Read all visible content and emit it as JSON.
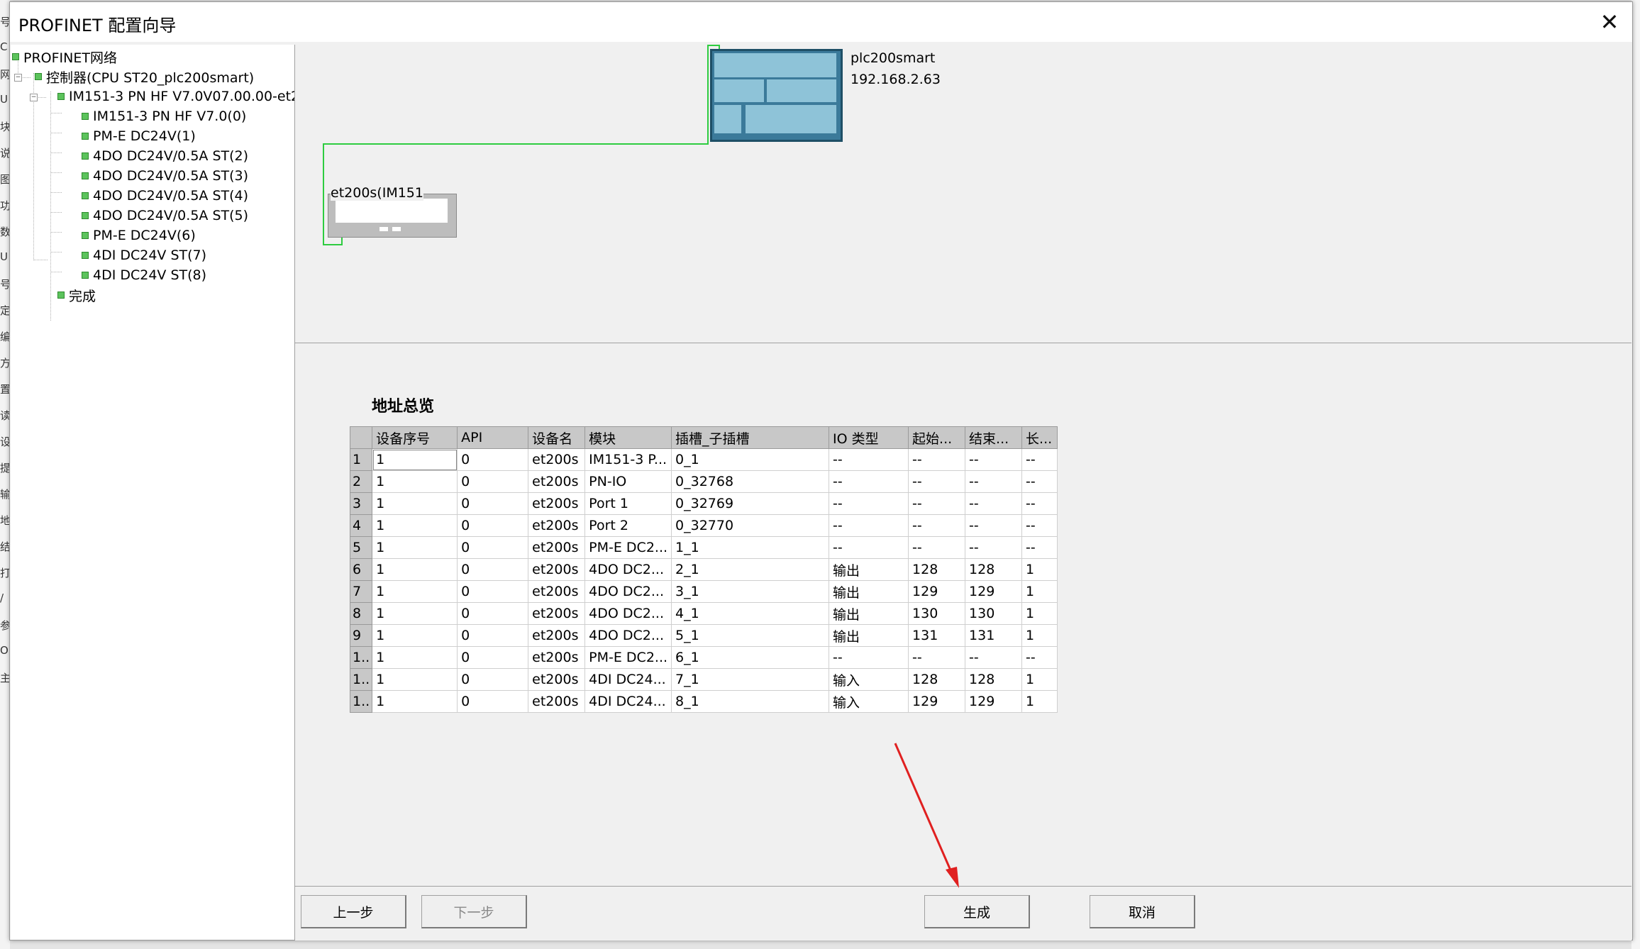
{
  "window": {
    "title": "PROFINET 配置向导"
  },
  "tree": {
    "root": "PROFINET网络",
    "controller": "控制器(CPU ST20_plc200smart)",
    "device": "IM151-3 PN HF V7.0V07.00.00-et2",
    "modules": [
      "IM151-3 PN HF V7.0(0)",
      "PM-E DC24V(1)",
      "4DO DC24V/0.5A ST(2)",
      "4DO DC24V/0.5A ST(3)",
      "4DO DC24V/0.5A ST(4)",
      "4DO DC24V/0.5A ST(5)",
      "PM-E DC24V(6)",
      "4DI DC24V ST(7)",
      "4DI DC24V ST(8)"
    ],
    "done": "完成"
  },
  "network": {
    "plc_name": "plc200smart",
    "plc_ip": "192.168.2.63",
    "device_label": "et200s(IM151"
  },
  "address_table": {
    "title": "地址总览",
    "columns": [
      "设备序号",
      "API",
      "设备名",
      "模块",
      "插槽_子插槽",
      "IO 类型",
      "起始...",
      "结束...",
      "长..."
    ],
    "rows": [
      {
        "idx": "1",
        "cells": [
          "1",
          "0",
          "et200s",
          "IM151-3 P...",
          "0_1",
          "--",
          "--",
          "--",
          "--"
        ]
      },
      {
        "idx": "2",
        "cells": [
          "1",
          "0",
          "et200s",
          "PN-IO",
          "0_32768",
          "--",
          "--",
          "--",
          "--"
        ]
      },
      {
        "idx": "3",
        "cells": [
          "1",
          "0",
          "et200s",
          "Port 1",
          "0_32769",
          "--",
          "--",
          "--",
          "--"
        ]
      },
      {
        "idx": "4",
        "cells": [
          "1",
          "0",
          "et200s",
          "Port 2",
          "0_32770",
          "--",
          "--",
          "--",
          "--"
        ]
      },
      {
        "idx": "5",
        "cells": [
          "1",
          "0",
          "et200s",
          "PM-E DC2...",
          "1_1",
          "--",
          "--",
          "--",
          "--"
        ]
      },
      {
        "idx": "6",
        "cells": [
          "1",
          "0",
          "et200s",
          "4DO DC2...",
          "2_1",
          "输出",
          "128",
          "128",
          "1"
        ]
      },
      {
        "idx": "7",
        "cells": [
          "1",
          "0",
          "et200s",
          "4DO DC2...",
          "3_1",
          "输出",
          "129",
          "129",
          "1"
        ]
      },
      {
        "idx": "8",
        "cells": [
          "1",
          "0",
          "et200s",
          "4DO DC2...",
          "4_1",
          "输出",
          "130",
          "130",
          "1"
        ]
      },
      {
        "idx": "9",
        "cells": [
          "1",
          "0",
          "et200s",
          "4DO DC2...",
          "5_1",
          "输出",
          "131",
          "131",
          "1"
        ]
      },
      {
        "idx": "1..",
        "cells": [
          "1",
          "0",
          "et200s",
          "PM-E DC2...",
          "6_1",
          "--",
          "--",
          "--",
          "--"
        ]
      },
      {
        "idx": "1..",
        "cells": [
          "1",
          "0",
          "et200s",
          "4DI DC24...",
          "7_1",
          "输入",
          "128",
          "128",
          "1"
        ]
      },
      {
        "idx": "1..",
        "cells": [
          "1",
          "0",
          "et200s",
          "4DI DC24...",
          "8_1",
          "输入",
          "129",
          "129",
          "1"
        ]
      }
    ]
  },
  "buttons": {
    "prev": "上一步",
    "next": "下一步",
    "generate": "生成",
    "cancel": "取消"
  },
  "background_fragments": [
    "号",
    "C",
    "网",
    "U",
    "块",
    "说",
    "图",
    "功",
    "数",
    "U",
    "号",
    "定",
    "编",
    "方",
    "置",
    "读",
    "设",
    "提",
    "输",
    "地",
    "结",
    "打",
    "/",
    "参",
    "OF",
    "主"
  ],
  "colors": {
    "network_line": "#2ecc40",
    "plc_body": "#3b7a9a",
    "annotation_arrow": "#e02020"
  }
}
